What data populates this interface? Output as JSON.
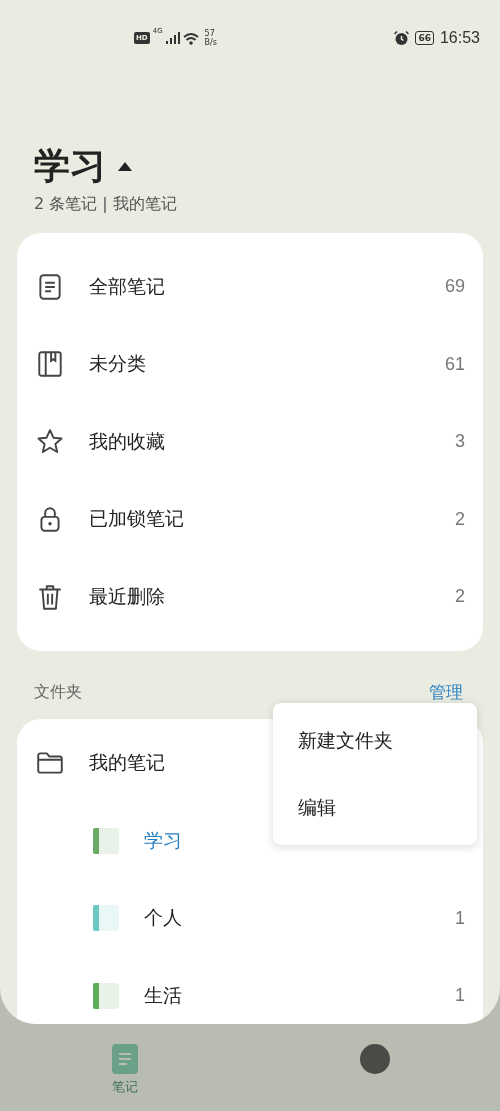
{
  "status_bar": {
    "hd": "HD",
    "network": "4G",
    "speed": "57",
    "speed_unit": "B/s",
    "battery": "66",
    "time": "16:53"
  },
  "header": {
    "title": "学习",
    "subtitle": "2 条笔记 | 我的笔记"
  },
  "categories": [
    {
      "kind": "all",
      "label": "全部笔记",
      "count": "69"
    },
    {
      "kind": "uncategorized",
      "label": "未分类",
      "count": "61"
    },
    {
      "kind": "favorites",
      "label": "我的收藏",
      "count": "3"
    },
    {
      "kind": "locked",
      "label": "已加锁笔记",
      "count": "2"
    },
    {
      "kind": "trash",
      "label": "最近删除",
      "count": "2"
    }
  ],
  "folders_section": {
    "title": "文件夹",
    "action": "管理"
  },
  "folders": [
    {
      "label": "我的笔记",
      "children": [
        {
          "label": "学习",
          "color": "#6aaa64",
          "selected": true
        },
        {
          "label": "个人",
          "color": "#6cc8c0",
          "selected": false,
          "count": "1"
        },
        {
          "label": "生活",
          "color": "#5fae5a",
          "selected": false,
          "count": "1"
        }
      ]
    }
  ],
  "menu": {
    "items": [
      "新建文件夹",
      "编辑"
    ]
  },
  "bottom_tabs": [
    {
      "kind": "notes",
      "label": "笔记",
      "selected": true
    },
    {
      "kind": "todo",
      "selected": false
    }
  ]
}
